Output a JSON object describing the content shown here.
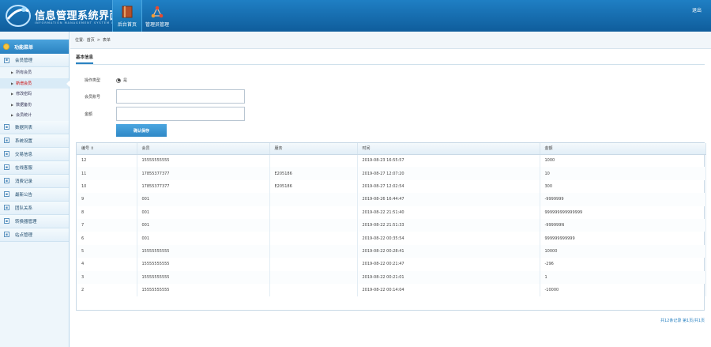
{
  "header": {
    "title": "信息管理系统界面",
    "subtitle": "INFORMATION MANAGEMENT SYSTEM INTERFACE",
    "nav": [
      {
        "label": "后台首页",
        "icon": "book-icon"
      },
      {
        "label": "管理员管理",
        "icon": "network-icon"
      }
    ],
    "exit_label": "退出"
  },
  "sidebar": {
    "head": "功能菜单",
    "group1": "会员管理",
    "sub_items": [
      "所有会员",
      "新增会员",
      "修改密码",
      "数据备份",
      "会员统计"
    ],
    "groups": [
      "数据列表",
      "系统设置",
      "交易信息",
      "在线客服",
      "消费记录",
      "最新公告",
      "团队关系",
      "转换器管理",
      "站点管理"
    ]
  },
  "breadcrumb": [
    "位置:",
    "首页",
    ">",
    "表单"
  ],
  "section_title": "基本信息",
  "form": {
    "type_label": "操作类型",
    "type_value": "是",
    "account_label": "会员账号",
    "account_value": "",
    "amount_label": "金额",
    "amount_value": "",
    "save_label": "确认保存"
  },
  "table": {
    "headers": [
      "编号",
      "会员",
      "服务",
      "时间",
      "金额"
    ],
    "rows": [
      [
        "12",
        "15555555555",
        "",
        "2019-08-23 16:55:57",
        "1000"
      ],
      [
        "11",
        "17855377377",
        "E205186",
        "2019-08-27 12:07:20",
        "10"
      ],
      [
        "10",
        "17855377377",
        "E205186",
        "2019-08-27 12:02:54",
        "300"
      ],
      [
        "9",
        "001",
        "",
        "2019-08-26 16:44:47",
        "-9999999"
      ],
      [
        "8",
        "001",
        "",
        "2019-08-22 21:51:40",
        "999999999999999"
      ],
      [
        "7",
        "001",
        "",
        "2019-08-22 21:51:33",
        "-999999N"
      ],
      [
        "6",
        "001",
        "",
        "2019-08-22 00:35:54",
        "999999999999"
      ],
      [
        "5",
        "15555555555",
        "",
        "2019-08-22 00:28:41",
        "10000"
      ],
      [
        "4",
        "15555555555",
        "",
        "2019-08-22 00:21:47",
        "-296"
      ],
      [
        "3",
        "15555555555",
        "",
        "2019-08-22 00:21:01",
        "1"
      ],
      [
        "2",
        "15555555555",
        "",
        "2019-08-22 00:14:04",
        "-10000"
      ]
    ]
  },
  "pager": "共12条记录 第1页/共1页"
}
